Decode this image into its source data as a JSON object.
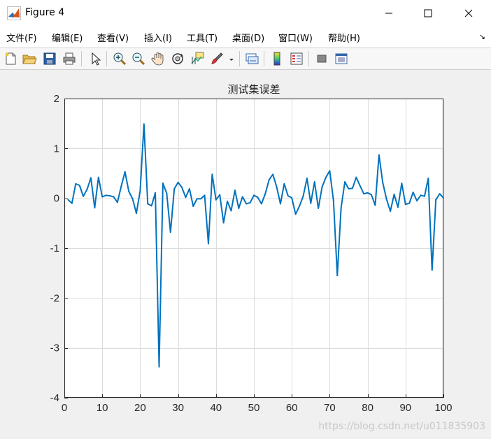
{
  "window": {
    "title": "Figure 4",
    "minimize_glyph": "—",
    "maximize_glyph": "☐",
    "close_glyph": "✕"
  },
  "menu": {
    "items": [
      {
        "label": "文件(F)"
      },
      {
        "label": "编辑(E)"
      },
      {
        "label": "查看(V)"
      },
      {
        "label": "插入(I)"
      },
      {
        "label": "工具(T)"
      },
      {
        "label": "桌面(D)"
      },
      {
        "label": "窗口(W)"
      },
      {
        "label": "帮助(H)"
      }
    ],
    "overflow_glyph": "↘"
  },
  "toolbar": {
    "icons": [
      "new-figure-icon",
      "open-file-icon",
      "save-icon",
      "print-icon",
      "pointer-icon",
      "zoom-in-icon",
      "zoom-out-icon",
      "pan-hand-icon",
      "rotate-3d-icon",
      "data-cursor-icon",
      "brush-icon",
      "brush-dropdown-icon",
      "link-plot-icon",
      "colorbar-icon",
      "legend-icon",
      "hide-plot-tools-icon",
      "show-plot-tools-icon"
    ]
  },
  "watermark": "https://blog.csdn.net/u011835903",
  "chart_data": {
    "type": "line",
    "title": "测试集误差",
    "xlabel": "",
    "ylabel": "",
    "xlim": [
      0,
      100
    ],
    "ylim": [
      -4,
      2
    ],
    "xticks": [
      0,
      10,
      20,
      30,
      40,
      50,
      60,
      70,
      80,
      90,
      100
    ],
    "yticks": [
      2,
      1,
      0,
      -1,
      -2,
      -3,
      -4
    ],
    "grid": true,
    "line_color": "#0072BD",
    "series": [
      {
        "x": [
          1,
          2,
          3,
          4,
          5,
          6,
          7,
          8,
          9,
          10,
          11,
          12,
          13,
          14,
          15,
          16,
          17,
          18,
          19,
          20,
          21,
          22,
          23,
          24,
          25,
          26,
          27,
          28,
          29,
          30,
          31,
          32,
          33,
          34,
          35,
          36,
          37,
          38,
          39,
          40,
          41,
          42,
          43,
          44,
          45,
          46,
          47,
          48,
          49,
          50,
          51,
          52,
          53,
          54,
          55,
          56,
          57,
          58,
          59,
          60,
          61,
          62,
          63,
          64,
          65,
          66,
          67,
          68,
          69,
          70,
          71,
          72,
          73,
          74,
          75,
          76,
          77,
          78,
          79,
          80,
          81,
          82,
          83,
          84,
          85,
          86,
          87,
          88,
          89,
          90,
          91,
          92,
          93,
          94,
          95,
          96,
          97,
          98,
          99,
          100
        ],
        "y": [
          -0.03,
          -0.1,
          0.29,
          0.26,
          0.04,
          0.18,
          0.41,
          -0.19,
          0.42,
          0.03,
          0.06,
          0.05,
          0.03,
          -0.08,
          0.24,
          0.53,
          0.14,
          -0.01,
          -0.3,
          0.15,
          1.49,
          -0.11,
          -0.15,
          0.11,
          -3.38,
          0.3,
          0.1,
          -0.68,
          0.19,
          0.32,
          0.22,
          0.02,
          0.19,
          -0.16,
          -0.01,
          -0.01,
          0.06,
          -0.91,
          0.48,
          -0.03,
          0.07,
          -0.49,
          -0.06,
          -0.25,
          0.16,
          -0.2,
          0.03,
          -0.11,
          -0.09,
          0.06,
          0.02,
          -0.11,
          0.09,
          0.37,
          0.48,
          0.23,
          -0.11,
          0.29,
          0.05,
          0.01,
          -0.32,
          -0.16,
          0.04,
          0.4,
          -0.1,
          0.33,
          -0.2,
          0.23,
          0.42,
          0.55,
          -0.05,
          -1.55,
          -0.19,
          0.33,
          0.19,
          0.2,
          0.42,
          0.25,
          0.09,
          0.11,
          0.07,
          -0.14,
          0.87,
          0.31,
          -0.02,
          -0.26,
          0.08,
          -0.18,
          0.3,
          -0.12,
          -0.1,
          0.12,
          -0.05,
          0.06,
          0.04,
          0.4,
          -1.44,
          -0.03,
          0.09,
          0.01
        ]
      }
    ]
  }
}
